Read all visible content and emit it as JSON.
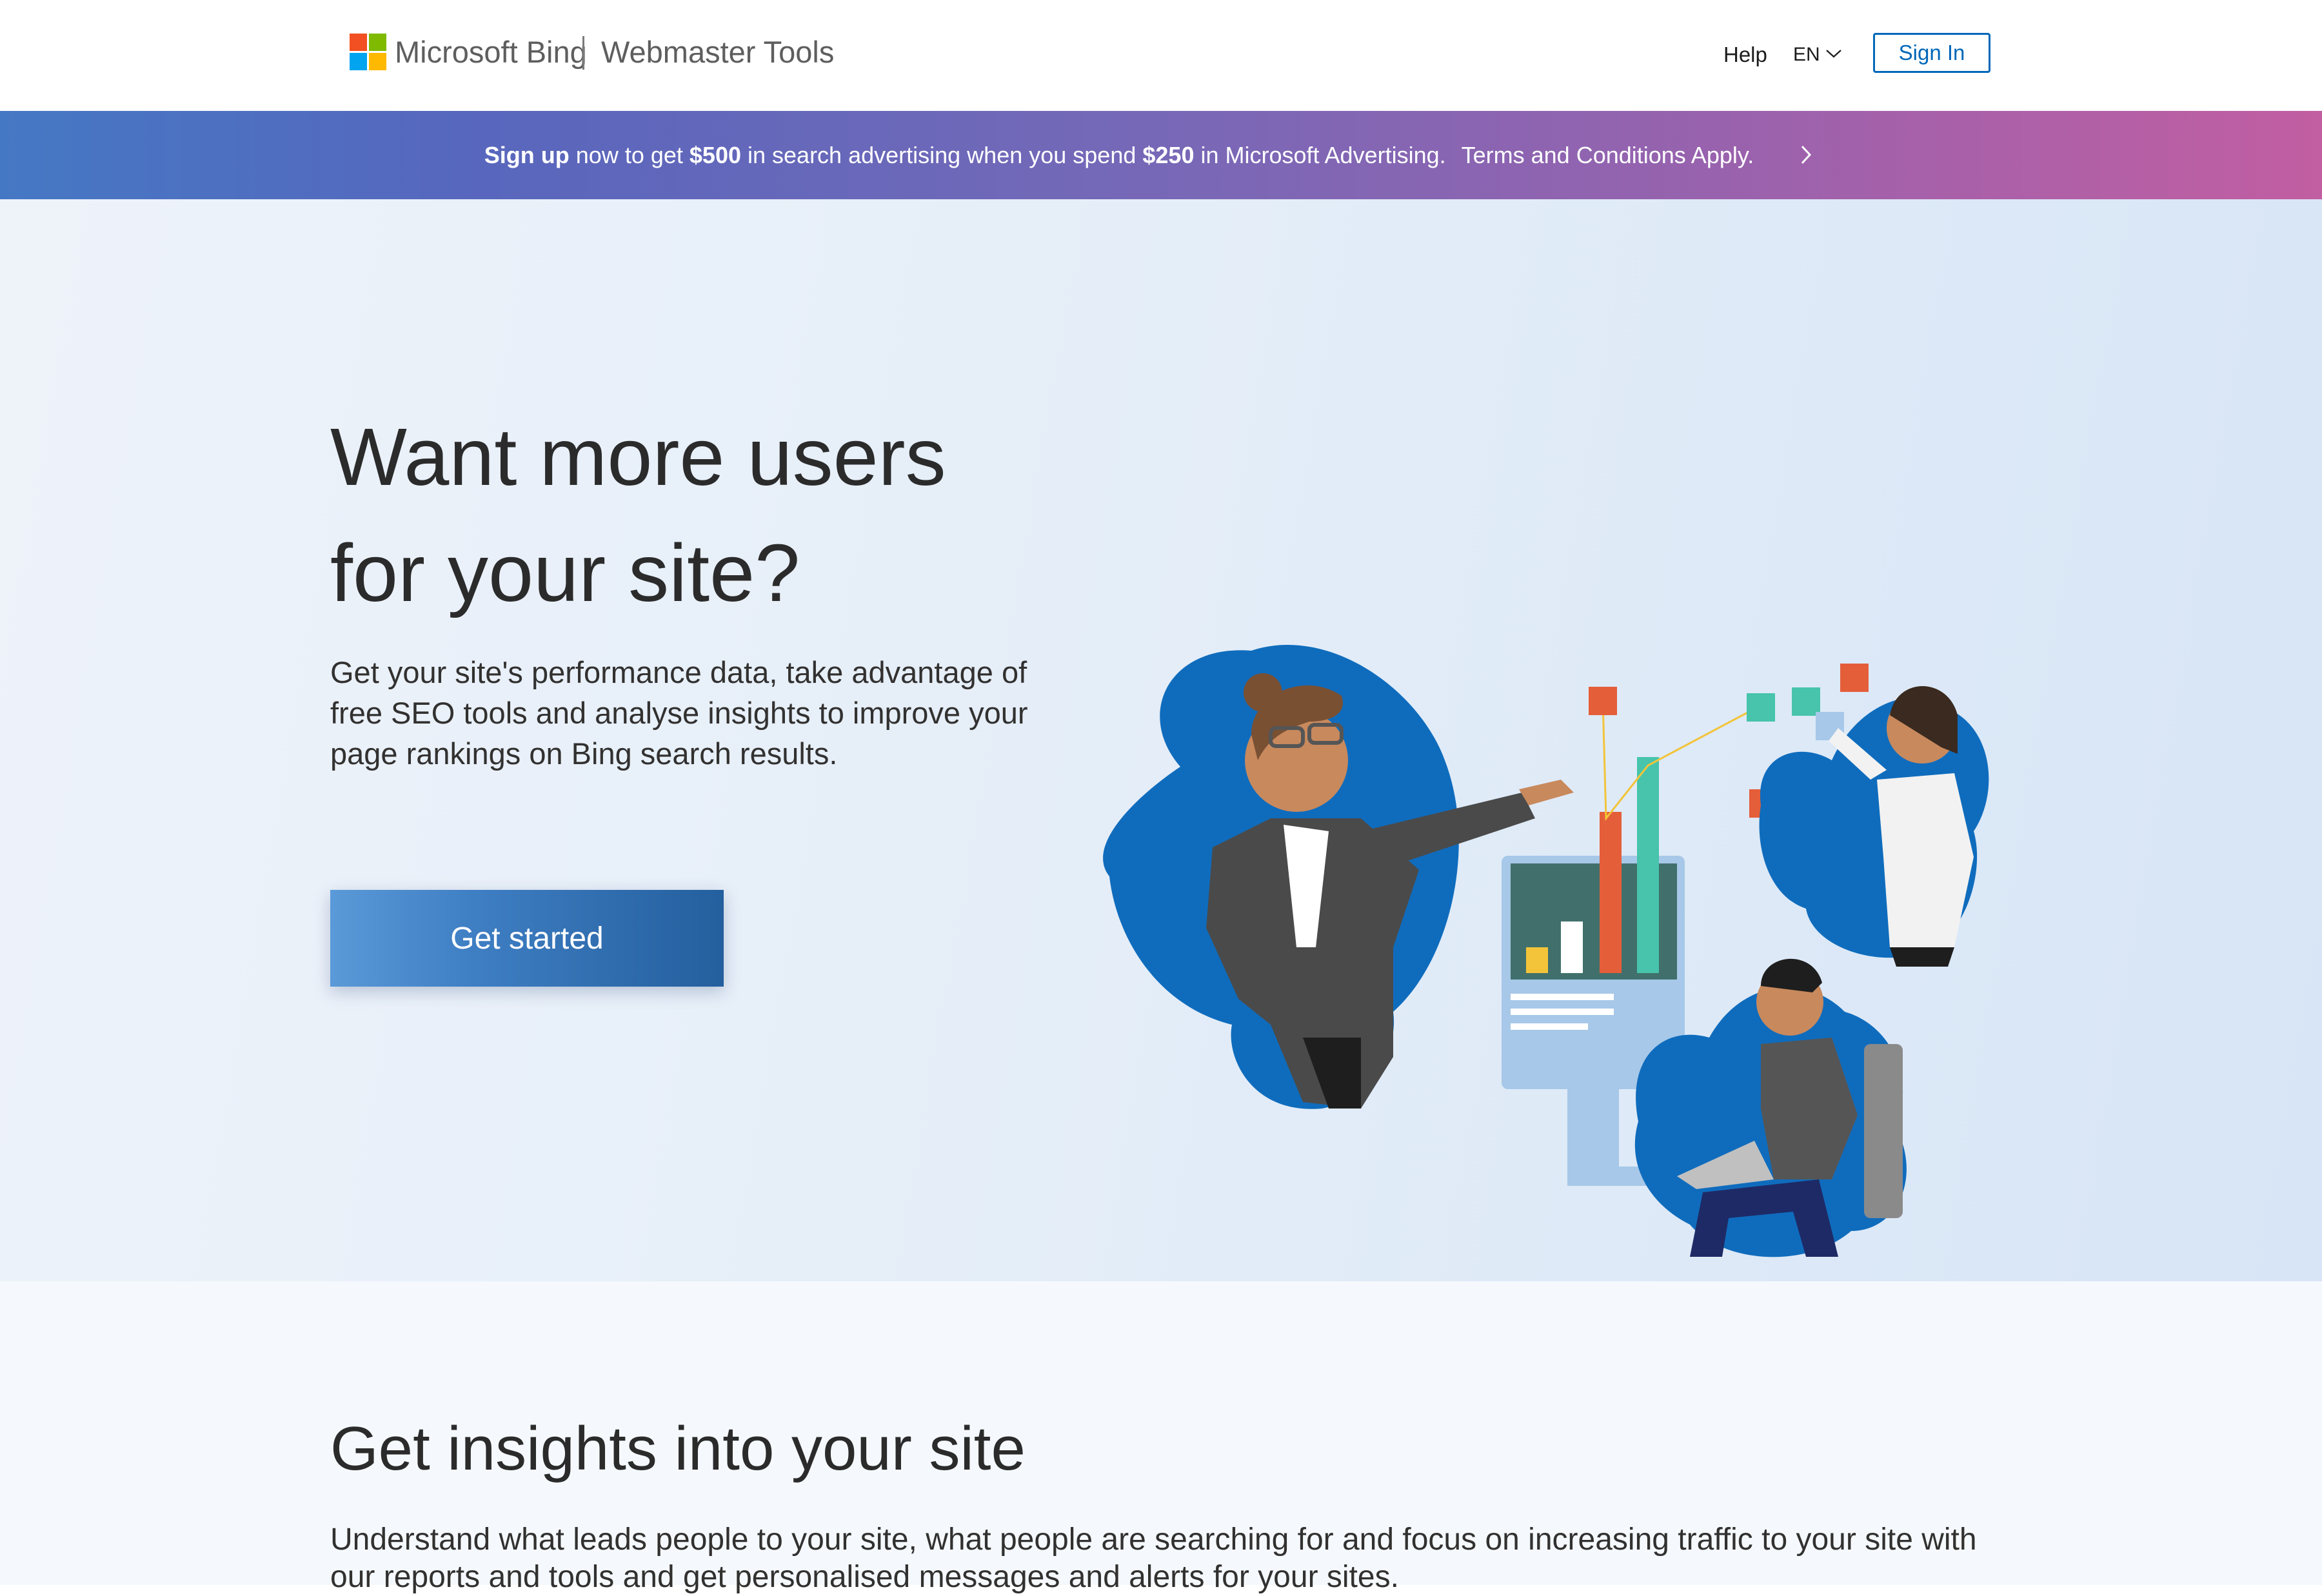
{
  "header": {
    "brand": "Microsoft Bing",
    "product": "Webmaster Tools",
    "help_label": "Help",
    "language": "EN",
    "signin_label": "Sign In",
    "logo_colors": [
      "#f25022",
      "#7fba00",
      "#00a4ef",
      "#ffb900"
    ]
  },
  "promo": {
    "part1": "Sign up",
    "part2": " now to get ",
    "part3": "$500",
    "part4": " in search advertising when you spend ",
    "part5": "$250",
    "part6": " in Microsoft Advertising.",
    "terms": "Terms and Conditions Apply.",
    "chevron_icon": "chevron-right-icon"
  },
  "hero": {
    "title_line1": "Want more users",
    "title_line2": "for your site?",
    "description": "Get your site's performance data, take advantage of free SEO tools and analyse insights to improve your page rankings on Bing search results.",
    "cta_label": "Get started"
  },
  "insights": {
    "title": "Get insights into your site",
    "description": "Understand what leads people to your site, what people are searching for and focus on increasing traffic to your site with our reports and tools and get personalised messages and alerts for your sites."
  },
  "colors": {
    "accent": "#0067b8",
    "blob_blue": "#0f6cbd"
  }
}
